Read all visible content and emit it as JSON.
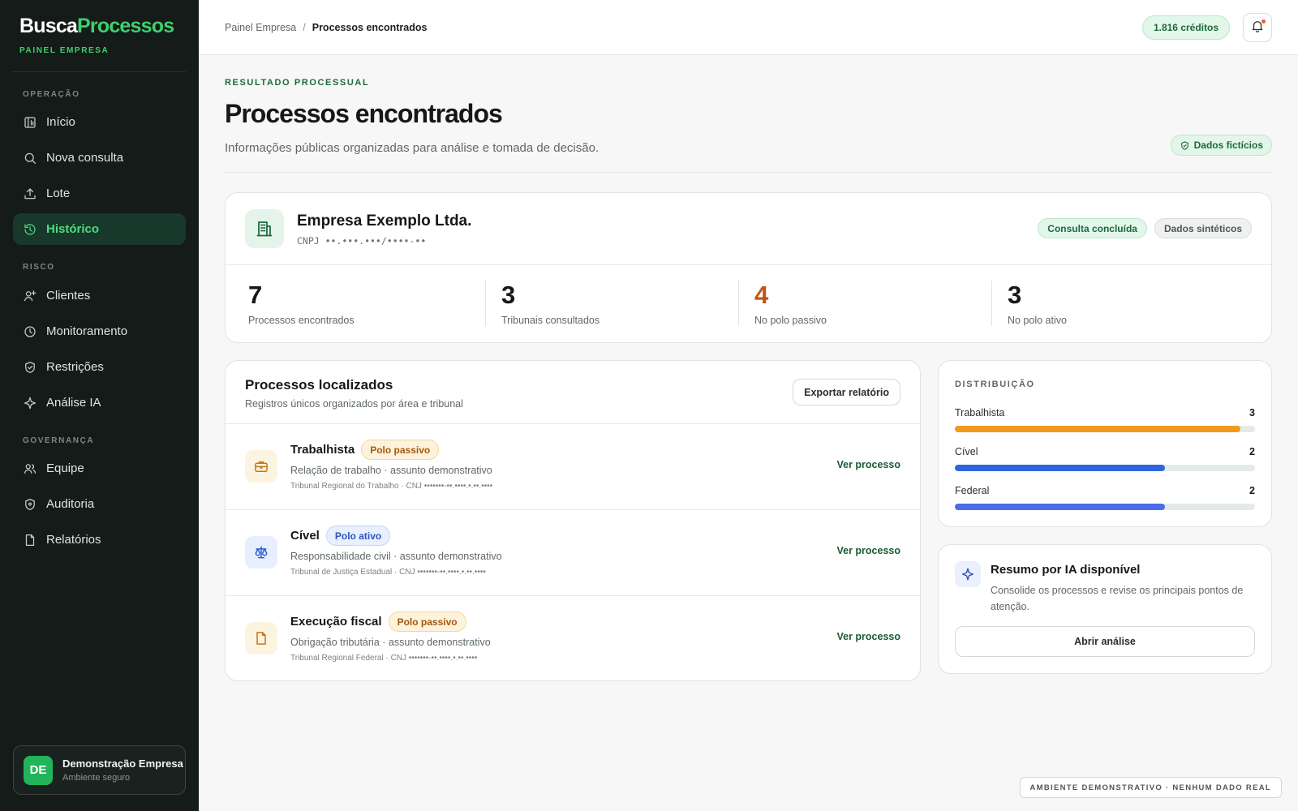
{
  "brand": {
    "part1": "Busca",
    "part2": "Processos",
    "subtitle": "PAINEL EMPRESA"
  },
  "sidebar": {
    "sections": [
      {
        "label": "OPERAÇÃO"
      },
      {
        "label": "RISCO"
      },
      {
        "label": "GOVERNANÇA"
      }
    ],
    "items": [
      {
        "label": "Início",
        "icon": "dashboard-icon"
      },
      {
        "label": "Nova consulta",
        "icon": "search-icon"
      },
      {
        "label": "Lote",
        "icon": "upload-icon"
      },
      {
        "label": "Histórico",
        "icon": "history-icon",
        "active": true
      },
      {
        "label": "Clientes",
        "icon": "user-plus-icon"
      },
      {
        "label": "Monitoramento",
        "icon": "clock-icon"
      },
      {
        "label": "Restrições",
        "icon": "shield-check-icon"
      },
      {
        "label": "Análise IA",
        "icon": "sparkle-icon"
      },
      {
        "label": "Equipe",
        "icon": "users-icon"
      },
      {
        "label": "Auditoria",
        "icon": "shield-icon"
      },
      {
        "label": "Relatórios",
        "icon": "file-icon"
      }
    ],
    "user": {
      "initials": "DE",
      "name": "Demonstração Empresa",
      "subtitle": "Ambiente seguro"
    }
  },
  "topbar": {
    "breadcrumb": [
      "Painel Empresa",
      "Processos encontrados"
    ],
    "separator": "/",
    "credits": "1.816 créditos"
  },
  "header": {
    "eyebrow": "RESULTADO PROCESSUAL",
    "title": "Processos encontrados",
    "subtitle": "Informações públicas organizadas para análise e tomada de decisão.",
    "badge": "Dados fictícios"
  },
  "company": {
    "name": "Empresa Exemplo Ltda.",
    "cnpj": "CNPJ ••.•••.•••/••••-••",
    "status": [
      "Consulta concluída",
      "Dados sintéticos"
    ],
    "stats": [
      {
        "value": "7",
        "label": "Processos encontrados"
      },
      {
        "value": "3",
        "label": "Tribunais consultados"
      },
      {
        "value": "4",
        "label": "No polo passivo"
      },
      {
        "value": "3",
        "label": "No polo ativo"
      }
    ]
  },
  "processes": {
    "title": "Processos localizados",
    "subtitle": "Registros únicos organizados por área e tribunal",
    "export_label": "Exportar relatório",
    "rows": [
      {
        "area": "Trabalhista",
        "tag": "Polo passivo",
        "desc": "Relação de trabalho · assunto demonstrativo",
        "meta": "Tribunal Regional do Trabalho · CNJ •••••••-••.••••.•.••.••••",
        "link": "Ver processo",
        "icon": "briefcase-icon"
      },
      {
        "area": "Cível",
        "tag": "Polo ativo",
        "desc": "Responsabilidade civil · assunto demonstrativo",
        "meta": "Tribunal de Justiça Estadual · CNJ •••••••-••.••••.•.••.••••",
        "link": "Ver processo",
        "icon": "scale-icon"
      },
      {
        "area": "Execução fiscal",
        "tag": "Polo passivo",
        "desc": "Obrigação tributária · assunto demonstrativo",
        "meta": "Tribunal Regional Federal · CNJ •••••••-••.••••.•.••.••••",
        "link": "Ver processo",
        "icon": "document-icon"
      }
    ]
  },
  "distribution": {
    "title": "DISTRIBUIÇÃO",
    "max": 3,
    "items": [
      {
        "label": "Trabalhista",
        "value": 3,
        "fill": 0.95,
        "color": "#f29b1b"
      },
      {
        "label": "Cível",
        "value": 2,
        "fill": 0.7,
        "color": "#2f66e0"
      },
      {
        "label": "Federal",
        "value": 2,
        "fill": 0.7,
        "color": "#4a6ce8"
      }
    ]
  },
  "ai_summary": {
    "title": "Resumo por IA disponível",
    "text": "Consolide os processos e revise os principais pontos de atenção.",
    "button": "Abrir análise"
  },
  "env_note": "AMBIENTE DEMONSTRATIVO · NENHUM DADO REAL",
  "colors": {
    "accent": "#3ecf6e",
    "sidebar_bg": "#141b19",
    "warn": "#c05417"
  }
}
